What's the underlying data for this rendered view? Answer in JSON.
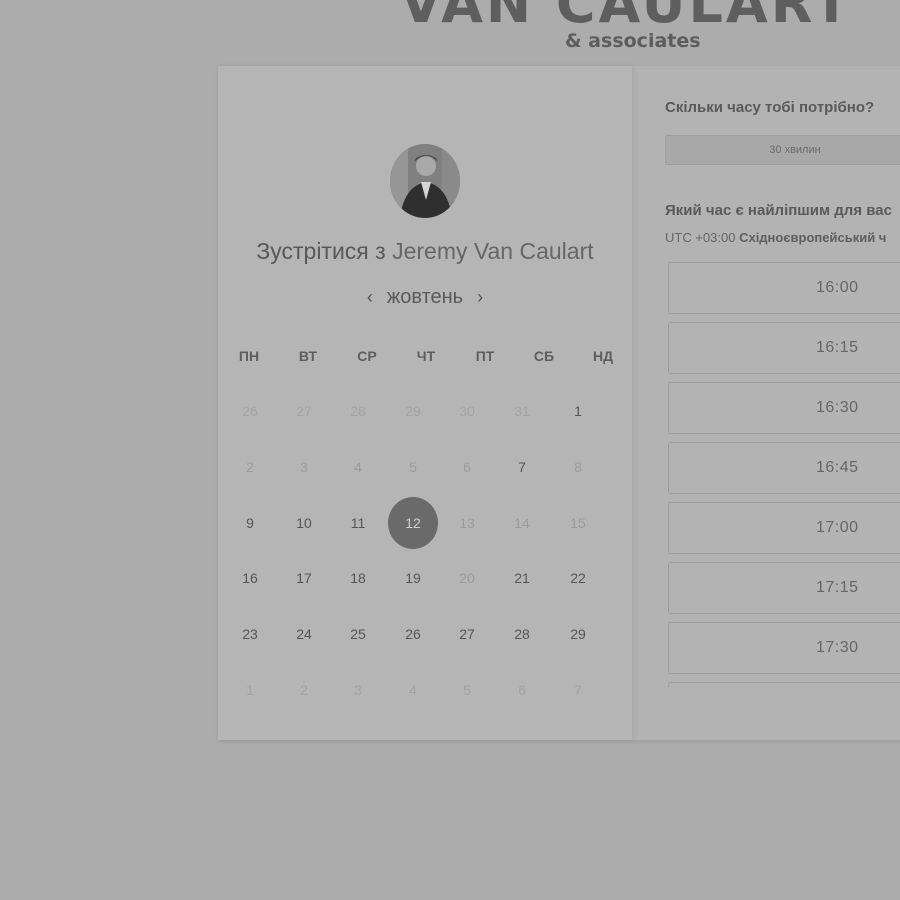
{
  "brand": {
    "main": "VAN CAULART",
    "sub": "& associates"
  },
  "meeting": {
    "prefix": "Зустрітися з",
    "name": "Jeremy Van Caulart"
  },
  "calendar": {
    "month": "жовтень",
    "prev_icon": "‹",
    "next_icon": "›",
    "weekdays": [
      "ПН",
      "ВТ",
      "СР",
      "ЧТ",
      "ПТ",
      "СБ",
      "НД"
    ],
    "weeks": [
      [
        {
          "d": "26",
          "s": "off"
        },
        {
          "d": "27",
          "s": "off"
        },
        {
          "d": "28",
          "s": "off"
        },
        {
          "d": "29",
          "s": "off"
        },
        {
          "d": "30",
          "s": "off"
        },
        {
          "d": "31",
          "s": "off"
        },
        {
          "d": "1",
          "s": "on"
        }
      ],
      [
        {
          "d": "2",
          "s": "muted"
        },
        {
          "d": "3",
          "s": "muted"
        },
        {
          "d": "4",
          "s": "muted"
        },
        {
          "d": "5",
          "s": "muted"
        },
        {
          "d": "6",
          "s": "muted"
        },
        {
          "d": "7",
          "s": "on"
        },
        {
          "d": "8",
          "s": "muted"
        }
      ],
      [
        {
          "d": "9",
          "s": "on"
        },
        {
          "d": "10",
          "s": "on"
        },
        {
          "d": "11",
          "s": "on"
        },
        {
          "d": "12",
          "s": "selected"
        },
        {
          "d": "13",
          "s": "muted"
        },
        {
          "d": "14",
          "s": "muted"
        },
        {
          "d": "15",
          "s": "muted"
        }
      ],
      [
        {
          "d": "16",
          "s": "on"
        },
        {
          "d": "17",
          "s": "on"
        },
        {
          "d": "18",
          "s": "on"
        },
        {
          "d": "19",
          "s": "on"
        },
        {
          "d": "20",
          "s": "muted"
        },
        {
          "d": "21",
          "s": "on"
        },
        {
          "d": "22",
          "s": "on"
        }
      ],
      [
        {
          "d": "23",
          "s": "on"
        },
        {
          "d": "24",
          "s": "on"
        },
        {
          "d": "25",
          "s": "on"
        },
        {
          "d": "26",
          "s": "on"
        },
        {
          "d": "27",
          "s": "on"
        },
        {
          "d": "28",
          "s": "on"
        },
        {
          "d": "29",
          "s": "on"
        }
      ],
      [
        {
          "d": "1",
          "s": "off"
        },
        {
          "d": "2",
          "s": "off"
        },
        {
          "d": "3",
          "s": "off"
        },
        {
          "d": "4",
          "s": "off"
        },
        {
          "d": "5",
          "s": "off"
        },
        {
          "d": "6",
          "s": "off"
        },
        {
          "d": "7",
          "s": "off"
        }
      ]
    ],
    "selected_date": "12"
  },
  "booking": {
    "duration_question": "Скільки часу тобі потрібно?",
    "duration_value": "30 хвилин",
    "time_question": "Який час є найліпшим для вас",
    "timezone_offset": "UTC +03:00",
    "timezone_name": "Східноєвропейський ч",
    "slots": [
      "16:00",
      "16:15",
      "16:30",
      "16:45",
      "17:00",
      "17:15",
      "17:30"
    ]
  },
  "colors": {
    "selected_day": "#6a6a6a",
    "background": "#acacac"
  }
}
